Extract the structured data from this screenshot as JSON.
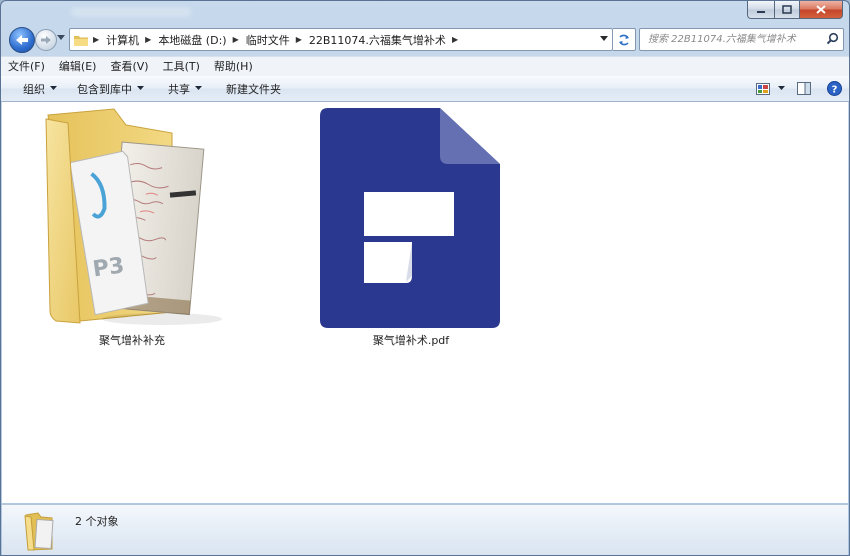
{
  "titlebar": {
    "controls": [
      "minimize",
      "maximize",
      "close"
    ]
  },
  "nav": {
    "breadcrumbs": [
      "计算机",
      "本地磁盘 (D:)",
      "临时文件",
      "22B11074.六福集气增补术"
    ],
    "search_placeholder": "搜索 22B11074.六福集气增补术"
  },
  "menubar": {
    "items": [
      "文件(F)",
      "编辑(E)",
      "查看(V)",
      "工具(T)",
      "帮助(H)"
    ]
  },
  "toolbar": {
    "organize": "组织",
    "include_library": "包含到库中",
    "share": "共享",
    "new_folder": "新建文件夹"
  },
  "files": [
    {
      "name": "聚气增补补充",
      "type": "folder",
      "preview_text": "P3"
    },
    {
      "name": "聚气增补术.pdf",
      "type": "pdf"
    }
  ],
  "colors": {
    "pdf_icon": "#2b388f",
    "folder": "#f2d678",
    "window_frame": "#b6cde6"
  },
  "status": {
    "count": "2 个对象"
  }
}
